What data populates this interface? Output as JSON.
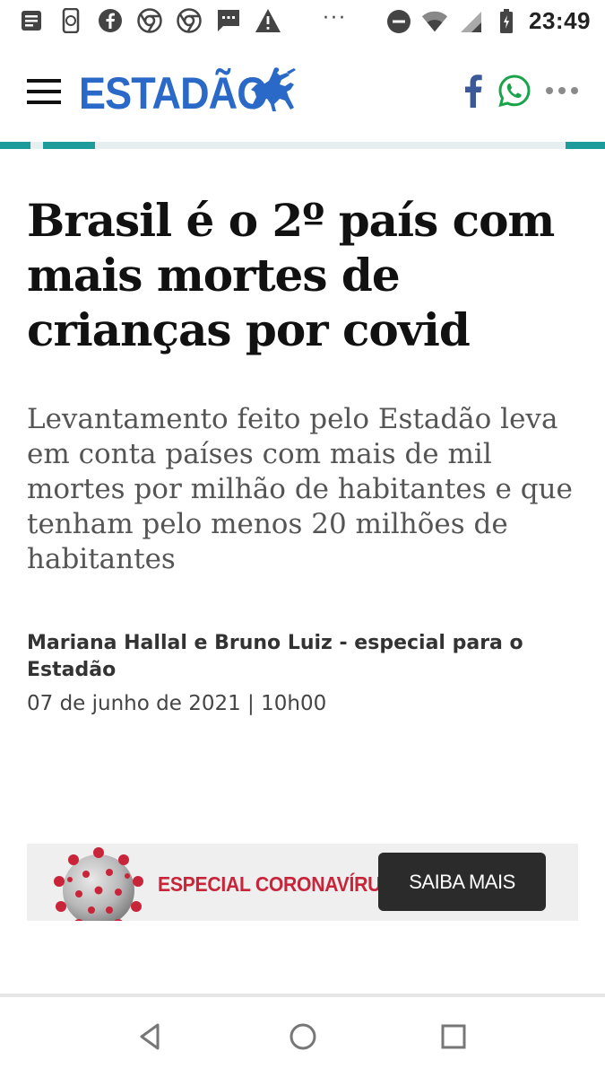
{
  "status_bar": {
    "time": "23:49",
    "overflow": "···",
    "icons": [
      "notes-icon",
      "phone-sync-icon",
      "facebook-icon",
      "chrome-icon",
      "chrome-icon",
      "message-icon",
      "warning-icon",
      "dnd-icon",
      "wifi-icon",
      "signal-icon",
      "battery-icon"
    ]
  },
  "header": {
    "logo": "ESTADÃO",
    "menu_icon": "hamburger-icon",
    "share": [
      "facebook-icon",
      "whatsapp-icon",
      "more-icon"
    ]
  },
  "colors": {
    "brand": "#2a69c8",
    "progress": "#1d9a9a",
    "banner_label": "#c8253a",
    "banner_button": "#2b2b2b"
  },
  "article": {
    "title": "Brasil é o 2º país com mais mortes de crianças por covid",
    "subtitle": "Levantamento feito pelo Estadão leva em conta países com mais de mil mortes por milhão de habitantes e que tenham pelo menos 20 milhões de habitantes",
    "author": "Mariana Hallal e Bruno Luiz - especial para o Estadão",
    "date": "07 de junho de 2021 | 10h00"
  },
  "banner": {
    "label": "ESPECIAL CORONAVÍRUS",
    "button": "SAIBA MAIS"
  },
  "nav": [
    "back-icon",
    "home-icon",
    "recents-icon"
  ]
}
